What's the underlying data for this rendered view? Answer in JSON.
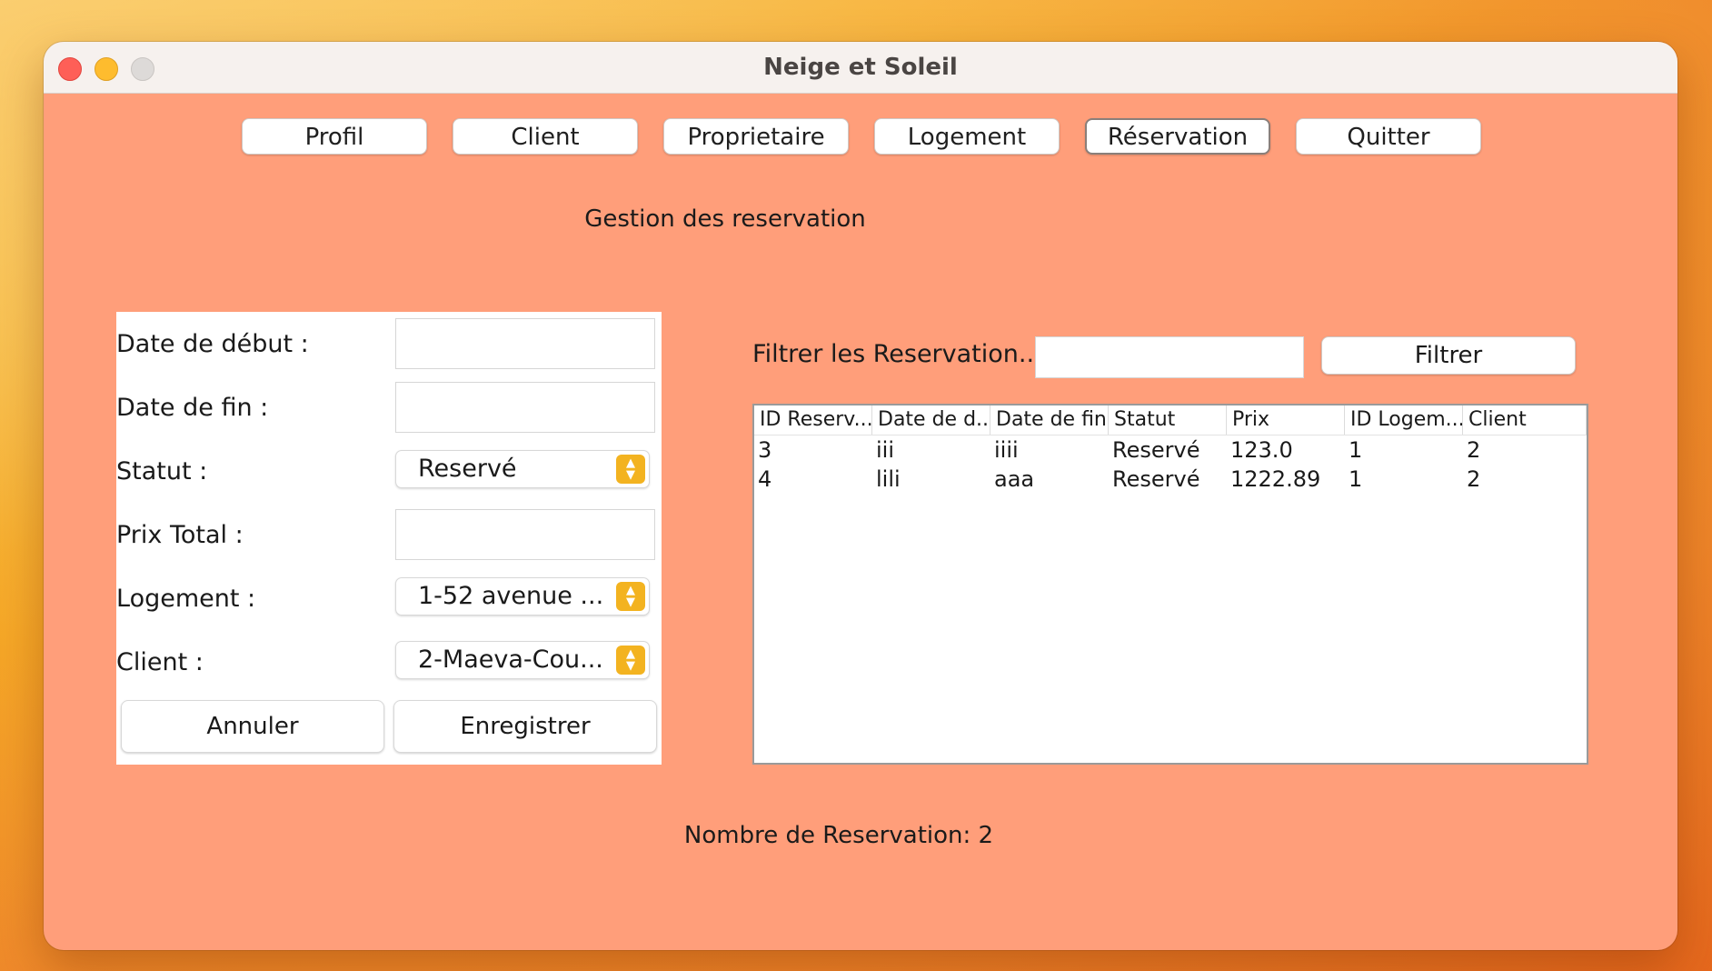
{
  "window": {
    "title": "Neige et Soleil"
  },
  "nav": {
    "items": [
      {
        "label": "Profil",
        "active": false
      },
      {
        "label": "Client",
        "active": false
      },
      {
        "label": "Proprietaire",
        "active": false
      },
      {
        "label": "Logement",
        "active": false
      },
      {
        "label": "Réservation",
        "active": true
      },
      {
        "label": "Quitter",
        "active": false
      }
    ]
  },
  "page": {
    "title": "Gestion des reservation"
  },
  "form": {
    "date_debut_label": "Date de début :",
    "date_debut_value": "",
    "date_fin_label": "Date de fin :",
    "date_fin_value": "",
    "statut_label": "Statut :",
    "statut_value": "Reservé",
    "prix_label": "Prix Total :",
    "prix_value": "",
    "logement_label": "Logement :",
    "logement_value": "1-52 avenue ...",
    "client_label": "Client :",
    "client_value": "2-Maeva-Cou...",
    "cancel_label": "Annuler",
    "save_label": "Enregistrer"
  },
  "filter": {
    "label": "Filtrer les Reservation...",
    "value": "",
    "button_label": "Filtrer"
  },
  "table": {
    "columns": [
      "ID Reserv...",
      "Date de d...",
      "Date de fin",
      "Statut",
      "Prix",
      "ID Logem...",
      "Client"
    ],
    "rows": [
      [
        "3",
        "iii",
        "iiii",
        "Reservé",
        "123.0",
        "1",
        "2"
      ],
      [
        "4",
        "lili",
        "aaa",
        "Reservé",
        "1222.89",
        "1",
        "2"
      ]
    ]
  },
  "footer": {
    "count_text": "Nombre de Reservation: 2"
  },
  "colors": {
    "background": "#ff9e7a",
    "accent": "#f3b320"
  }
}
